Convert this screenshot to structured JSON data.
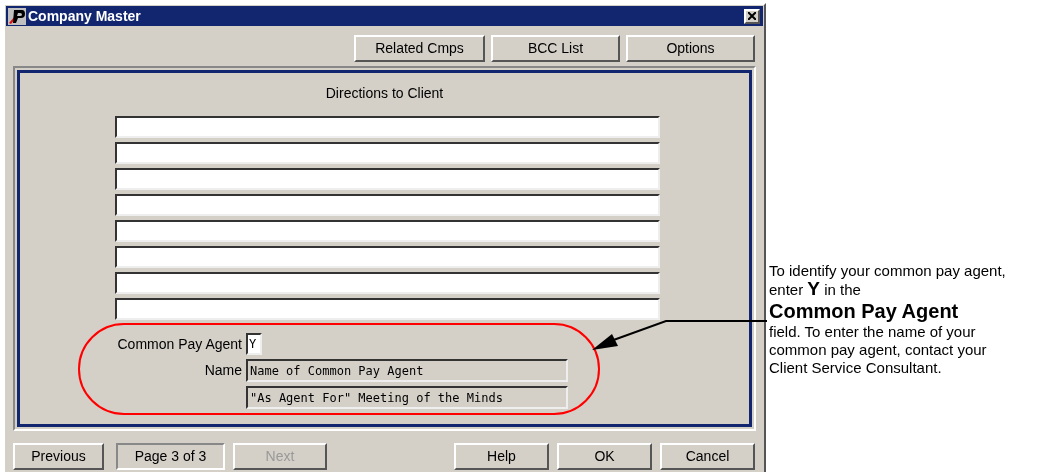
{
  "window": {
    "title": "Company Master"
  },
  "toolbar": [
    {
      "label": "Related Cmps"
    },
    {
      "label": "BCC List"
    },
    {
      "label": "Options"
    }
  ],
  "directions": {
    "title": "Directions to Client"
  },
  "common_pay_agent": {
    "label": "Common Pay Agent",
    "value": "Y"
  },
  "name": {
    "label": "Name",
    "lines": [
      "Name of Common Pay Agent",
      "\"As Agent For\" Meeting of the Minds"
    ]
  },
  "footer": {
    "previous": {
      "label": "Previous",
      "disabled": false
    },
    "page": "Page 3 of 3",
    "next": {
      "label": "Next",
      "disabled": true
    },
    "buttons": [
      {
        "label": "Help",
        "disabled": false
      },
      {
        "label": "OK",
        "disabled": false
      },
      {
        "label": "Cancel",
        "disabled": false
      }
    ]
  },
  "callout": {
    "intro": "To identify your common pay agent, enter **Y** in the",
    "heading": "Common Pay Agent",
    "body": "field. To enter the name of your common pay agent, contact your Client Service Consultant."
  }
}
